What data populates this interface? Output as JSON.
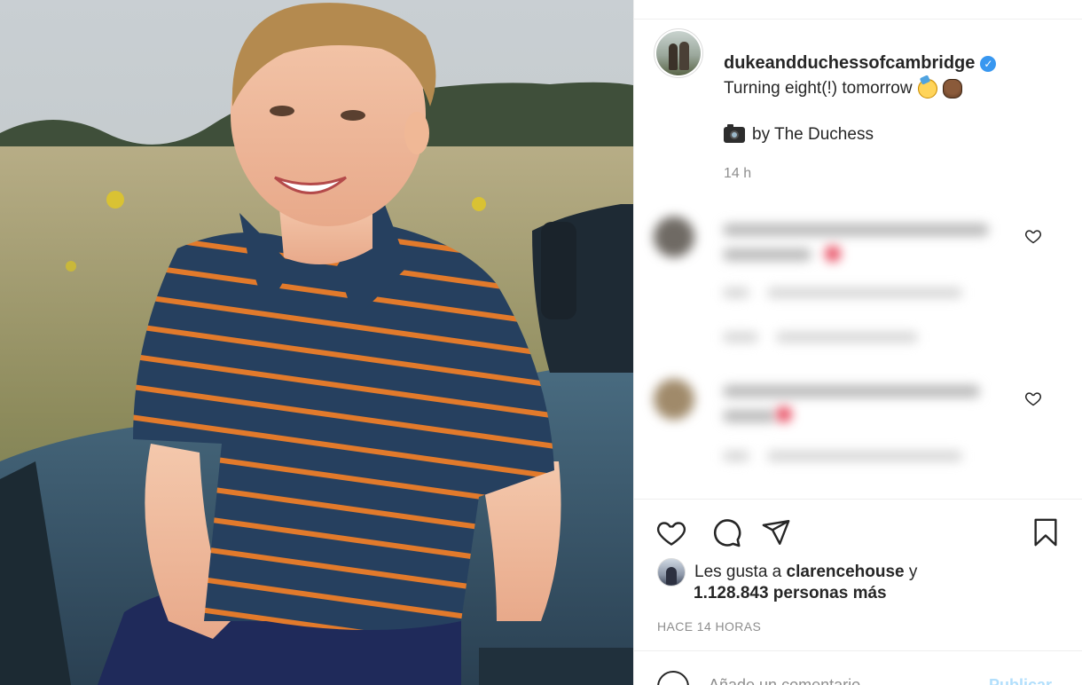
{
  "post": {
    "username": "dukeandduchessofcambridge",
    "verified_icon": "verified-badge-icon",
    "caption_line1": "Turning eight(!) tomorrow",
    "caption_line2": "by The Duchess",
    "time_short": "14 h"
  },
  "actions": {
    "like_icon": "heart-icon",
    "comment_icon": "speech-bubble-icon",
    "share_icon": "paper-plane-icon",
    "save_icon": "bookmark-icon"
  },
  "likes": {
    "prefix": "Les gusta a",
    "liker": "clarencehouse",
    "suffix": "y",
    "others": "1.128.843 personas más"
  },
  "posted_ago": "HACE 14 HORAS",
  "comment_box": {
    "placeholder": "Añade un comentario...",
    "publish_label": "Publicar"
  },
  "colors": {
    "verified": "#3897f0",
    "secondary_text": "#8e8e8e",
    "publish_disabled": "#b2dffc"
  }
}
